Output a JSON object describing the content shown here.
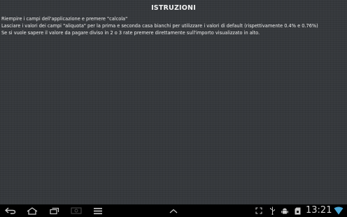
{
  "header": {
    "title": "ISTRUZIONI"
  },
  "instructions": {
    "line1": "Riempire i campi dell'applicazione e premere \"calcola\"",
    "line2": "Lasciare i valori dei campi \"aliquota\" per la prima e seconda casa bianchi per utilizzare i valori di default (rispettivamente 0.4% e 0.76%)",
    "line3": "Se si vuole sapere il valore da pagare diviso in 2 o 3 rate premere direttamente sull'importo visualizzato in alto."
  },
  "system_bar": {
    "clock": "13:21",
    "icons": [
      "back-icon",
      "home-icon",
      "recent-apps-icon",
      "screenshot-icon",
      "menu-icon",
      "chevron-up-icon",
      "fullscreen-icon",
      "usb-icon",
      "android-debug-icon",
      "sd-card-icon",
      "wifi-icon"
    ],
    "icon_color": "#c8c8c8",
    "wifi_color": "#4aa8d8"
  }
}
